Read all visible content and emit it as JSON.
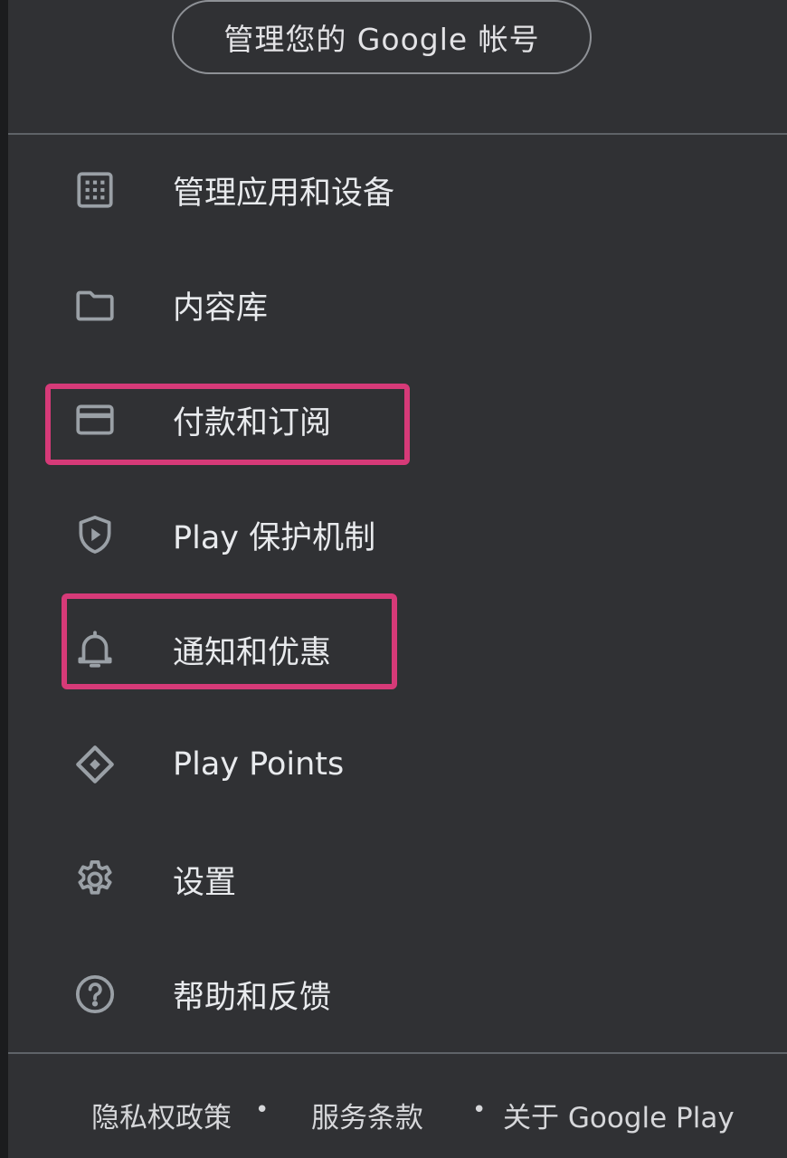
{
  "header": {
    "manage_account_label": "管理您的 Google 帐号"
  },
  "menu": {
    "items": [
      {
        "label": "管理应用和设备",
        "icon": "grid-icon"
      },
      {
        "label": "内容库",
        "icon": "folder-icon"
      },
      {
        "label": "付款和订阅",
        "icon": "credit-card-icon",
        "highlighted": true
      },
      {
        "label": "Play 保护机制",
        "icon": "shield-play-icon"
      },
      {
        "label": "通知和优惠",
        "icon": "bell-icon",
        "highlighted": true
      },
      {
        "label": "Play Points",
        "icon": "diamond-icon"
      },
      {
        "label": "设置",
        "icon": "gear-icon"
      },
      {
        "label": "帮助和反馈",
        "icon": "help-icon"
      }
    ]
  },
  "footer": {
    "privacy": "隐私权政策",
    "separator": "•",
    "terms": "服务条款",
    "about": "关于 Google Play"
  },
  "colors": {
    "background": "#303134",
    "text": "#e8eaed",
    "icon": "#9aa0a6",
    "highlight": "#d63a78",
    "divider": "#5f6368"
  }
}
